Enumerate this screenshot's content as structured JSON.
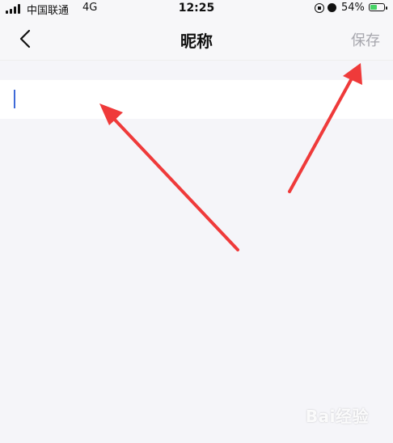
{
  "status_bar": {
    "carrier": "中国联通",
    "network": "4G",
    "time": "12:25",
    "battery_percent_text": "54%",
    "battery_level": 0.54,
    "icons": [
      "signal-icon",
      "orientation-lock-icon",
      "alarm-icon",
      "battery-icon"
    ]
  },
  "nav": {
    "back_icon": "chevron-left-icon",
    "title": "昵称",
    "save_label": "保存"
  },
  "form": {
    "nickname_value": "",
    "placeholder": ""
  },
  "watermark": "Bai经验"
}
